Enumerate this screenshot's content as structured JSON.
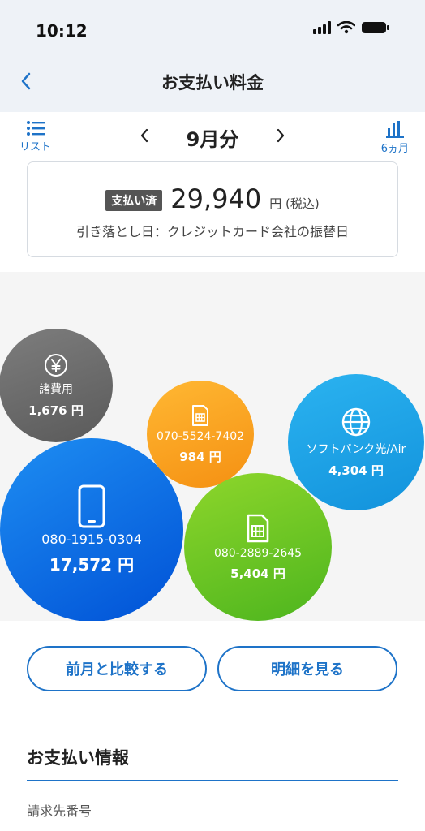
{
  "status_bar": {
    "time": "10:12"
  },
  "header": {
    "title": "お支払い料金"
  },
  "month_nav": {
    "month_label": "9月分",
    "list_label": "リスト",
    "chart_label": "6ヵ月"
  },
  "payment": {
    "status": "支払い済",
    "amount": "29,940",
    "unit": "円 (税込)",
    "debit_text": "引き落とし日：クレジットカード会社の振替日"
  },
  "bubbles": [
    {
      "label": "諸費用",
      "amount": "1,676 円",
      "color": "#6e6e6e",
      "icon": "yen-icon"
    },
    {
      "label": "080-1915-0304",
      "amount": "17,572 円",
      "color": "#0a6de6",
      "icon": "smartphone-icon"
    },
    {
      "label": "070-5524-7402",
      "amount": "984 円",
      "color": "#f7a21d",
      "icon": "sim-card-icon"
    },
    {
      "label": "ソフトバンク光/Air",
      "amount": "4,304 円",
      "color": "#1fa3e6",
      "icon": "globe-icon"
    },
    {
      "label": "080-2889-2645",
      "amount": "5,404 円",
      "color": "#6cc624",
      "icon": "sim-card-icon"
    }
  ],
  "buttons": {
    "compare": "前月と比較する",
    "detail": "明細を見る"
  },
  "info": {
    "title": "お支払い情報",
    "billing_number_label": "請求先番号"
  },
  "colors": {
    "accent": "#1e73c8",
    "nav_bg": "#eef2f7"
  }
}
